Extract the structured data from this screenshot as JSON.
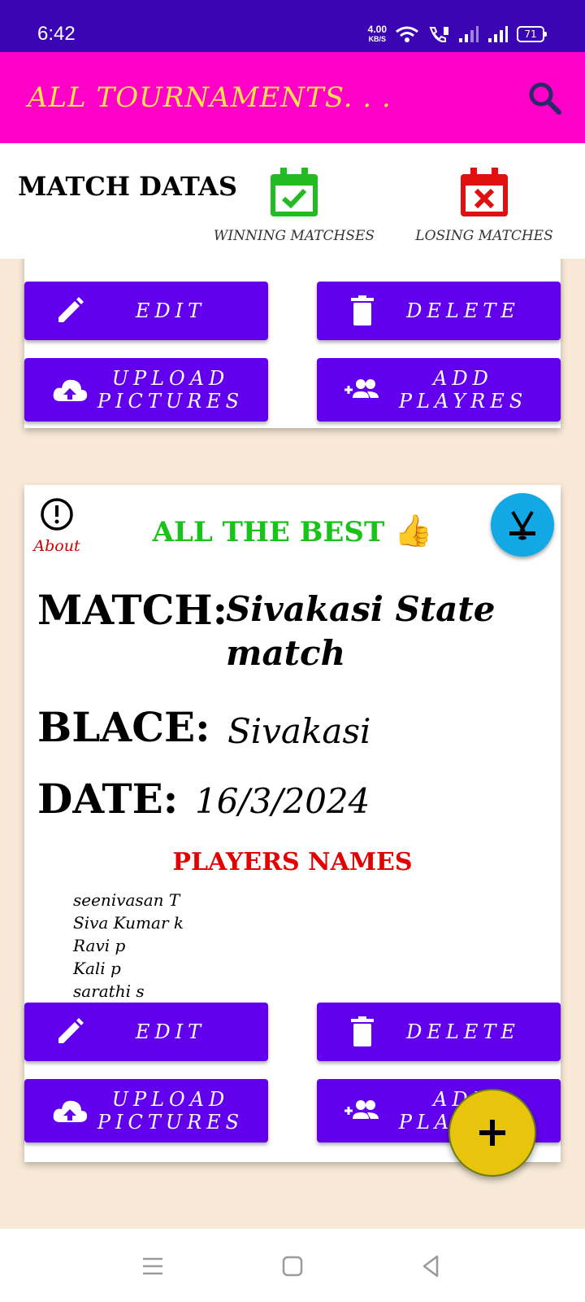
{
  "status": {
    "time": "6:42",
    "net_speed_top": "4.00",
    "net_speed_bottom": "KB/S",
    "battery": "71"
  },
  "appbar": {
    "title": "ALL TOURNAMENTS. . ."
  },
  "tabs": {
    "title": "MATCH DATAS",
    "winning_label": "WINNING MATCHSES",
    "losing_label": "LOSING MATCHES"
  },
  "buttons": {
    "edit": "EDIT",
    "delete": "DELETE",
    "upload": "UPLOAD PICTURES",
    "add_players": "ADD PLAYRES"
  },
  "card": {
    "about_label": "About",
    "greeting": "ALL THE BEST",
    "greeting_emoji": "👍",
    "match_label": "MATCH:",
    "match_value": "Sivakasi State match",
    "place_label": "BLACE:",
    "place_value": "Sivakasi",
    "date_label": "DATE:",
    "date_value": "16/3/2024",
    "players_title": "PLAYERS NAMES",
    "players": [
      "seenivasan T",
      "Siva Kumar k",
      "Ravi p",
      "Kali p",
      "sarathi s"
    ]
  },
  "colors": {
    "status_bar": "#3b05b3",
    "app_bar": "#ff00c8",
    "title_text": "#ffe34a",
    "button": "#6200ee",
    "background": "#f7e9d6",
    "fab": "#e8c40c",
    "win": "#22bb22",
    "lose": "#e01010"
  },
  "icons": {
    "search": "search-icon",
    "win": "calendar-check-icon",
    "lose": "calendar-x-icon",
    "edit": "pencil-icon",
    "delete": "trash-icon",
    "upload": "cloud-upload-icon",
    "add_players": "person-add-icon",
    "about": "info-icon",
    "hockey": "hockey-icon",
    "fab": "plus-icon"
  }
}
